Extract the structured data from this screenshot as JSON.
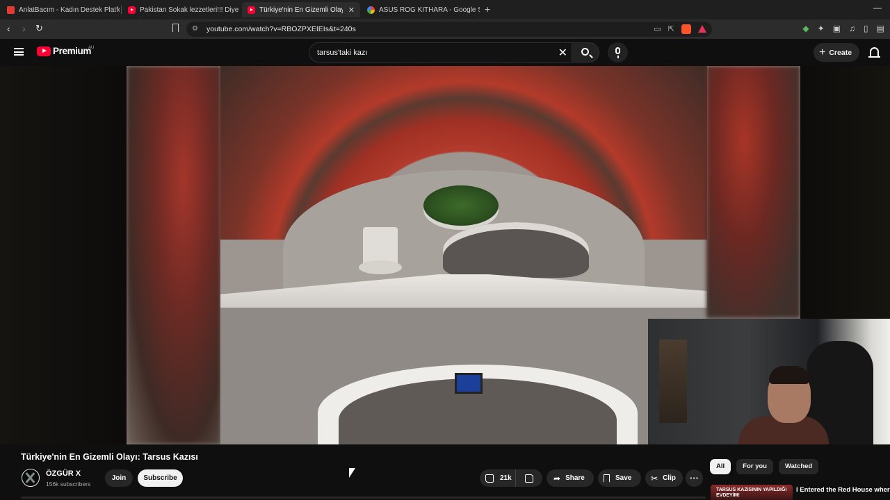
{
  "browser": {
    "tabs": [
      {
        "title": "AnlatBacım - Kadın Destek Platformu",
        "icon": "red-square-icon"
      },
      {
        "title": "Pakistan Sokak lezzetleri!!! Diye diye",
        "icon": "youtube-icon"
      },
      {
        "title": "Türkiye'nin En Gizemli Olayı: T",
        "icon": "youtube-icon",
        "active": true
      },
      {
        "title": "ASUS ROG KITHARA - Google Search",
        "icon": "google-icon"
      }
    ],
    "url": "youtube.com/watch?v=RBOZPXEIEIs&t=240s"
  },
  "masthead": {
    "logo_text": "Premium",
    "country": "AU",
    "search_value": "tarsus'taki kazı",
    "create_label": "Create"
  },
  "video": {
    "title": "Türkiye'nin En Gizemli Olayı: Tarsus Kazısı",
    "channel_name": "ÖZGÜR X",
    "subscribers": "156k subscribers",
    "join_label": "Join",
    "subscribe_label": "Subscribe",
    "likes": "21k",
    "share_label": "Share",
    "save_label": "Save",
    "clip_label": "Clip",
    "more_label": "···"
  },
  "sidebar": {
    "chips": [
      "All",
      "For you",
      "Watched"
    ],
    "active_chip": "All",
    "rec_thumb_text": "TARSUS KAZISININ YAPILDIĞI EVDEYİM!",
    "rec_title": "I Entered the Red House where the Excavation in Tarsus was..."
  }
}
